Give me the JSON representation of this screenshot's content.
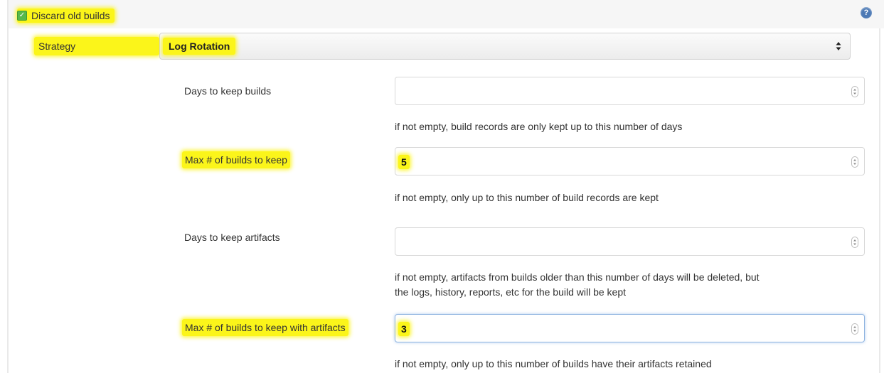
{
  "header": {
    "checkbox_label": "Discard old builds",
    "checkbox_checked": true,
    "help_icon": "help-circle-icon",
    "help_glyph": "?"
  },
  "strategy": {
    "label": "Strategy",
    "value": "Log Rotation"
  },
  "fields": {
    "days_to_keep": {
      "label": "Days to keep builds",
      "value": "",
      "help": "if not empty, build records are only kept up to this number of days"
    },
    "max_builds": {
      "label": "Max # of builds to keep",
      "value": "5",
      "help": "if not empty, only up to this number of build records are kept"
    },
    "artifact_days": {
      "label": "Days to keep artifacts",
      "value": "",
      "help_line1": "if not empty, artifacts from builds older than this number of days will be deleted, but",
      "help_line2": "the logs, history, reports, etc for the build will be kept"
    },
    "artifact_max": {
      "label": "Max # of builds to keep with artifacts",
      "value": "3",
      "help": "if not empty, only up to this number of builds have their artifacts retained"
    }
  },
  "colors": {
    "highlight": "#fbf51a",
    "checkbox_green": "#57b94a",
    "help_blue": "#4d7ab5",
    "focus_border": "#8fb4e0"
  }
}
